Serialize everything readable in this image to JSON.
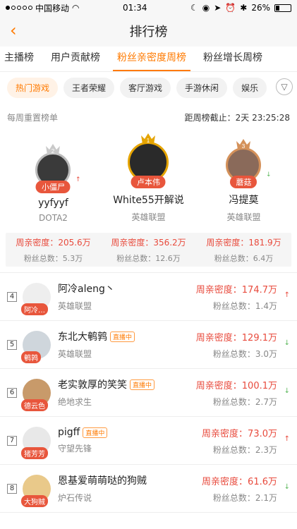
{
  "status": {
    "carrier": "中国移动",
    "time": "01:34",
    "battery": "26%"
  },
  "nav": {
    "title": "排行榜"
  },
  "tabs": [
    {
      "label": "主播榜",
      "active": false
    },
    {
      "label": "用户贡献榜",
      "active": false
    },
    {
      "label": "粉丝亲密度周榜",
      "active": true
    },
    {
      "label": "粉丝增长周榜",
      "active": false
    }
  ],
  "chips": [
    {
      "label": "热门游戏",
      "active": true
    },
    {
      "label": "王者荣耀",
      "active": false
    },
    {
      "label": "客厅游戏",
      "active": false
    },
    {
      "label": "手游休闲",
      "active": false
    },
    {
      "label": "娱乐",
      "active": false
    }
  ],
  "meta": {
    "left": "每周重置榜单",
    "right": "距周榜截止：2天 23:25:28"
  },
  "podium": [
    {
      "rank": "2",
      "tag": "小僵尸",
      "name": "yyfyyf",
      "game": "DOTA2",
      "trend": "↑",
      "intimacy": "周亲密度：205.6万",
      "fans": "粉丝总数：5.3万"
    },
    {
      "rank": "1",
      "tag": "卢本伟",
      "name": "White55开解说",
      "game": "英雄联盟",
      "trend": "",
      "intimacy": "周亲密度：356.2万",
      "fans": "粉丝总数：12.6万"
    },
    {
      "rank": "3",
      "tag": "蘑菇",
      "name": "冯提莫",
      "game": "英雄联盟",
      "trend": "↓",
      "intimacy": "周亲密度：181.9万",
      "fans": "粉丝总数：6.4万"
    }
  ],
  "list": [
    {
      "rank": "4",
      "tag": "阿冷…",
      "name": "阿冷aleng丶",
      "live": "",
      "game": "英雄联盟",
      "intimacy": "周亲密度：174.7万",
      "fans": "粉丝总数：1.4万",
      "trend": "↑"
    },
    {
      "rank": "5",
      "tag": "鹌鹑",
      "name": "东北大鹌鹑",
      "live": "直播中",
      "game": "英雄联盟",
      "intimacy": "周亲密度：129.1万",
      "fans": "粉丝总数：3.0万",
      "trend": "↓"
    },
    {
      "rank": "6",
      "tag": "德云色",
      "name": "老实敦厚的笑笑",
      "live": "直播中",
      "game": "绝地求生",
      "intimacy": "周亲密度：100.1万",
      "fans": "粉丝总数：2.7万",
      "trend": "↓"
    },
    {
      "rank": "7",
      "tag": "猪芳芳",
      "name": "pigff",
      "live": "直播中",
      "game": "守望先锋",
      "intimacy": "周亲密度：73.0万",
      "fans": "粉丝总数：2.3万",
      "trend": "↑"
    },
    {
      "rank": "8",
      "tag": "大狗贼",
      "name": "恩基爱萌萌哒的狗贼",
      "live": "",
      "game": "炉石传说",
      "intimacy": "周亲密度：61.6万",
      "fans": "粉丝总数：2.1万",
      "trend": "↓"
    }
  ],
  "colors": {
    "accent": "#ff7a00",
    "highlight": "#e84a3c",
    "gold": "#e5a400",
    "silver": "#bbbbbb",
    "bronze": "#d4915a"
  }
}
